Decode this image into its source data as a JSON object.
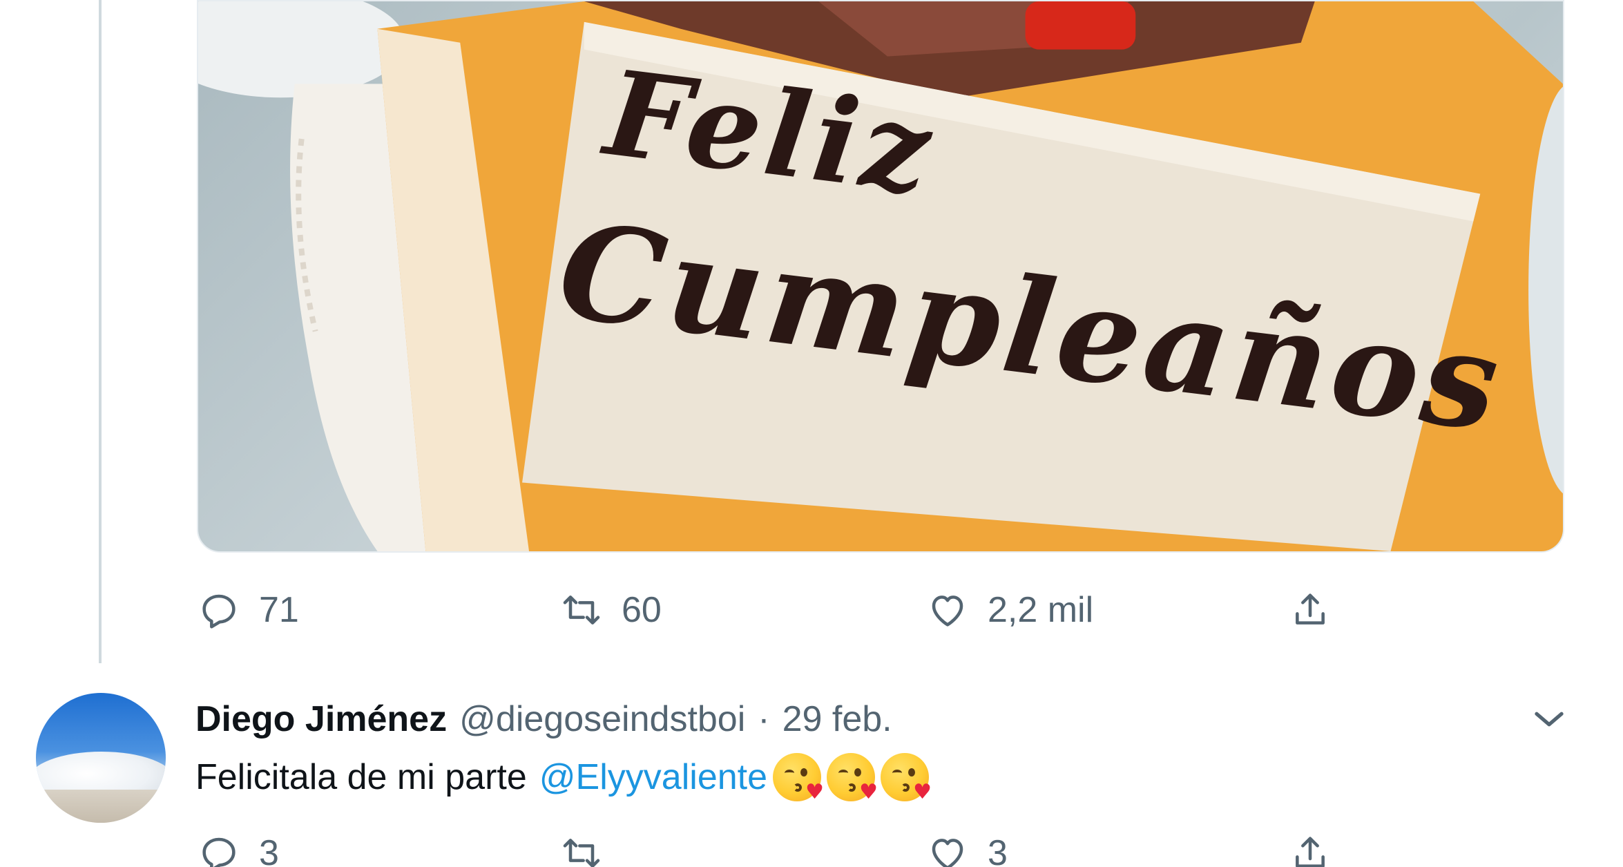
{
  "tweet": {
    "image_text": {
      "line1": "Feliz",
      "line2": "Cumpleaños"
    },
    "actions": {
      "reply_count": "71",
      "retweet_count": "60",
      "like_count": "2,2 mil"
    }
  },
  "reply": {
    "display_name": "Diego Jiménez",
    "handle": "@diegoseindstboi",
    "separator": "·",
    "date": "29 feb.",
    "text": "Felicitala de mi parte",
    "mention": "@Elyyvaliente",
    "actions": {
      "reply_count": "3",
      "retweet_count": "",
      "like_count": "3"
    }
  },
  "icons": [
    "reply-icon",
    "retweet-icon",
    "like-icon",
    "share-icon",
    "chevron-down-icon",
    "kiss-emoji-icon"
  ],
  "colors": {
    "link": "#1b95e0",
    "secondary_text": "#536471",
    "primary_text": "#0f1419",
    "thread_line": "#cfd9de"
  }
}
